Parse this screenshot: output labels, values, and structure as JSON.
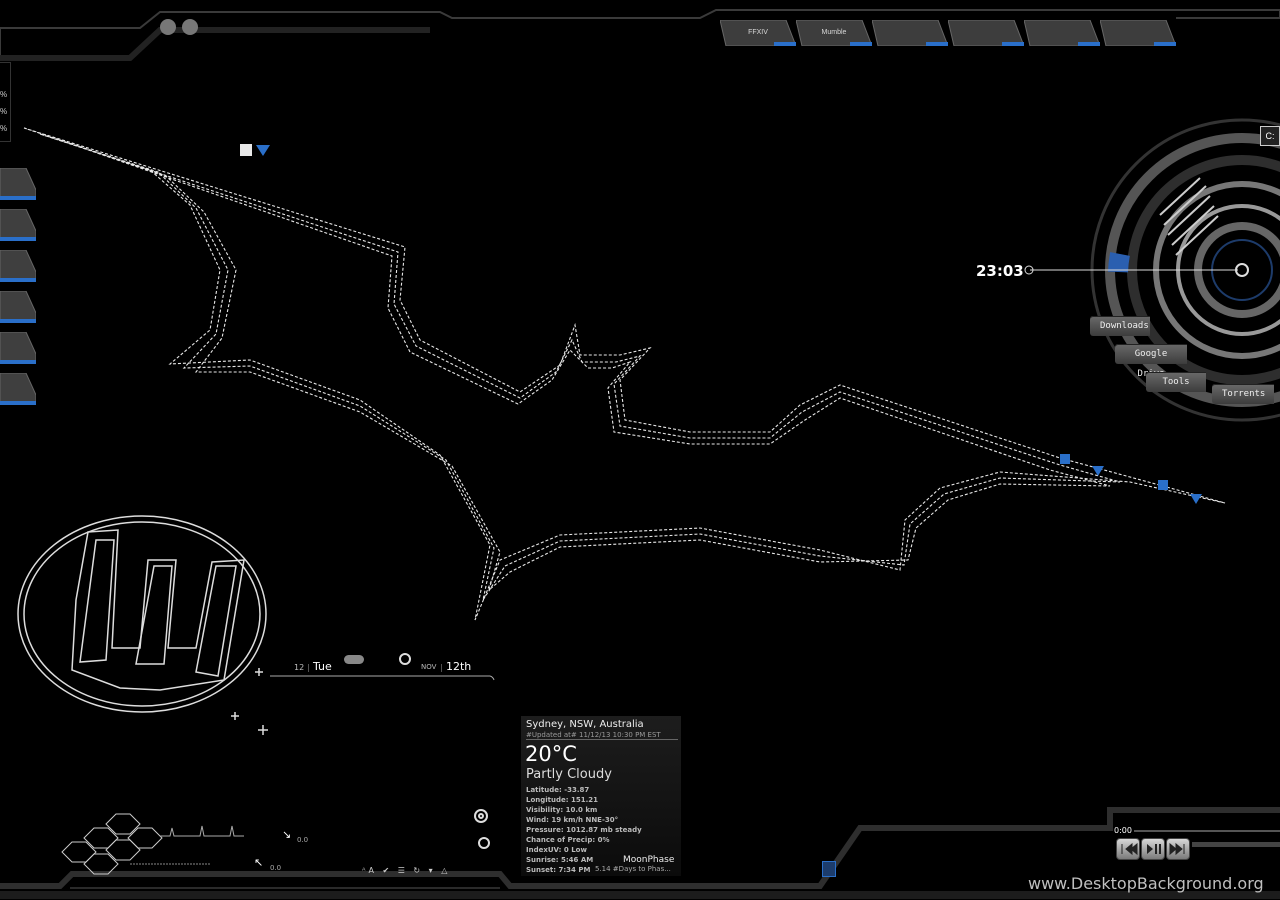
{
  "taskbar": {
    "tabs": [
      {
        "label": "FFXIV"
      },
      {
        "label": "Mumble"
      },
      {
        "label": ""
      },
      {
        "label": ""
      },
      {
        "label": ""
      },
      {
        "label": ""
      }
    ]
  },
  "left_panel": {
    "percentages": [
      "%",
      "%",
      "%"
    ]
  },
  "system_dial": {
    "time": "23:03",
    "drive": "C:",
    "shortcuts": [
      {
        "label": "Downloads"
      },
      {
        "label": "Google Drive"
      },
      {
        "label": "Tools"
      },
      {
        "label": "Torrents"
      }
    ],
    "accent_color": "#2a6fc9"
  },
  "date_widget": {
    "day_num": "12",
    "day_name": "Tue",
    "month": "NOV",
    "day_ordinal": "12th"
  },
  "weather": {
    "city": "Sydney, NSW, Australia",
    "updated": "#Updated at# 11/12/13 10:30 PM EST",
    "temperature": "20°C",
    "condition": "Partly Cloudy",
    "details": [
      "Latitude: -33.87",
      "Longitude: 151.21",
      "Visibility: 10.0 km",
      "Wind: 19 km/h NNE-30°",
      "Pressure: 1012.87 mb steady",
      "Chance of Precip: 0%",
      "IndexUV: 0 Low",
      "Sunrise: 5:46 AM",
      "Sunset: 7:34 PM"
    ],
    "moon_label": "MoonPhase",
    "moon_detail": "5.14 #Days to Phas..."
  },
  "network": {
    "down": "0.0",
    "up": "0.0"
  },
  "player": {
    "time": "0:00"
  },
  "watermark": "www.DesktopBackground.org"
}
